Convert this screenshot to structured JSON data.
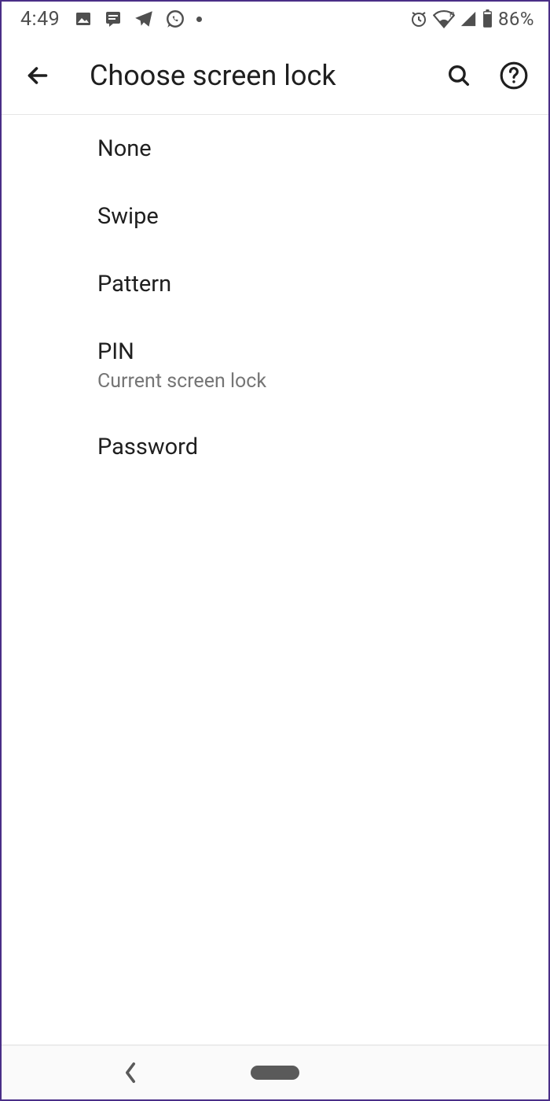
{
  "status": {
    "time": "4:49",
    "battery_pct": "86%",
    "icons_left": [
      "photos-icon",
      "message-icon",
      "telegram-icon",
      "whatsapp-icon",
      "dot-icon"
    ],
    "icons_right": [
      "alarm-icon",
      "wifi-icon",
      "signal-icon",
      "battery-icon"
    ]
  },
  "appbar": {
    "title": "Choose screen lock"
  },
  "options": [
    {
      "label": "None"
    },
    {
      "label": "Swipe"
    },
    {
      "label": "Pattern"
    },
    {
      "label": "PIN",
      "sub": "Current screen lock"
    },
    {
      "label": "Password"
    }
  ]
}
